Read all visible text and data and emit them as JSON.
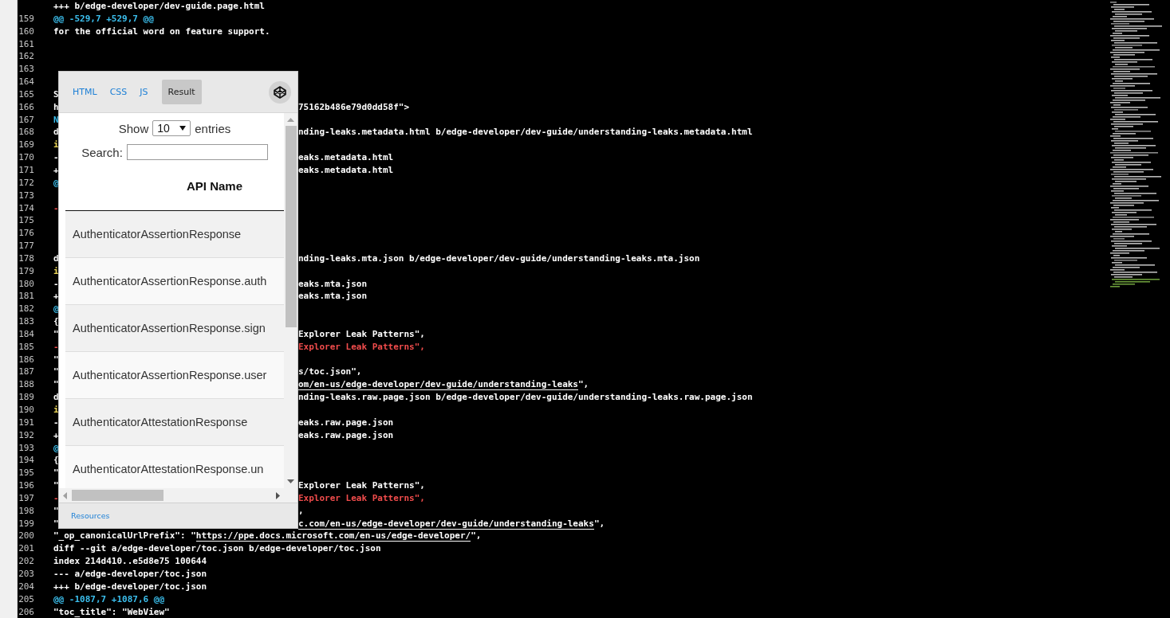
{
  "editor": {
    "lines": [
      {
        "left": [
          {
            "text": "+++ b/edge-developer/dev-guide.page.html",
            "kind": "plain",
            "link": false
          }
        ]
      },
      {
        "number": "159",
        "left": [
          {
            "text": "@@ -529,7 +529,7 @@",
            "kind": "hunk",
            "link": false
          }
        ]
      },
      {
        "number": "160",
        "left": [
          {
            "text": "for the official word on feature support.",
            "kind": "plain",
            "link": false
          }
        ]
      },
      {
        "number": "161"
      },
      {
        "number": "162"
      },
      {
        "number": "163"
      },
      {
        "number": "164"
      },
      {
        "number": "165",
        "left": [
          {
            "text": "S",
            "kind": "plain",
            "link": false
          }
        ]
      },
      {
        "number": "166",
        "left": [
          {
            "text": "h",
            "kind": "plain",
            "link": false
          }
        ],
        "right": [
          {
            "text": "75162b486e79d0dd58f\">",
            "kind": "plain",
            "link": false
          }
        ]
      },
      {
        "number": "167",
        "left": [
          {
            "text": "N",
            "kind": "hunk",
            "link": false
          }
        ]
      },
      {
        "number": "168",
        "left": [
          {
            "text": "d",
            "kind": "plain",
            "link": false
          }
        ],
        "right": [
          {
            "text": "nding-leaks.metadata.html b/edge-developer/dev-guide/understanding-leaks.metadata.html",
            "kind": "plain",
            "link": false
          }
        ]
      },
      {
        "number": "169",
        "left": [
          {
            "text": "i",
            "kind": "meta",
            "link": false
          }
        ]
      },
      {
        "number": "170",
        "left": [
          {
            "text": "-",
            "kind": "plain",
            "link": false
          }
        ],
        "right": [
          {
            "text": "eaks.metadata.html",
            "kind": "plain",
            "link": false
          }
        ]
      },
      {
        "number": "171",
        "left": [
          {
            "text": "+",
            "kind": "plain",
            "link": false
          }
        ],
        "right": [
          {
            "text": "eaks.metadata.html",
            "kind": "plain",
            "link": false
          }
        ]
      },
      {
        "number": "172",
        "left": [
          {
            "text": "@",
            "kind": "hunk",
            "link": false
          }
        ]
      },
      {
        "number": "173"
      },
      {
        "number": "174",
        "left": [
          {
            "text": "-",
            "kind": "removed",
            "link": false
          }
        ]
      },
      {
        "number": "175"
      },
      {
        "number": "176"
      },
      {
        "number": "177"
      },
      {
        "number": "178",
        "left": [
          {
            "text": "d",
            "kind": "plain",
            "link": false
          }
        ],
        "right": [
          {
            "text": "nding-leaks.mta.json b/edge-developer/dev-guide/understanding-leaks.mta.json",
            "kind": "plain",
            "link": false
          }
        ]
      },
      {
        "number": "179",
        "left": [
          {
            "text": "i",
            "kind": "meta",
            "link": false
          }
        ]
      },
      {
        "number": "180",
        "left": [
          {
            "text": "-",
            "kind": "plain",
            "link": false
          }
        ],
        "right": [
          {
            "text": "eaks.mta.json",
            "kind": "plain",
            "link": false
          }
        ]
      },
      {
        "number": "181",
        "left": [
          {
            "text": "+",
            "kind": "plain",
            "link": false
          }
        ],
        "right": [
          {
            "text": "eaks.mta.json",
            "kind": "plain",
            "link": false
          }
        ]
      },
      {
        "number": "182",
        "left": [
          {
            "text": "@",
            "kind": "hunk",
            "link": false
          }
        ]
      },
      {
        "number": "183",
        "left": [
          {
            "text": "{",
            "kind": "plain",
            "link": false
          }
        ]
      },
      {
        "number": "184",
        "left": [
          {
            "text": "\"",
            "kind": "plain",
            "link": false
          }
        ],
        "right": [
          {
            "text": "Explorer Leak Patterns\",",
            "kind": "plain",
            "link": false
          }
        ]
      },
      {
        "number": "185",
        "left": [
          {
            "text": "-",
            "kind": "removed",
            "link": false
          }
        ],
        "right": [
          {
            "text": "Explorer Leak Patterns\",",
            "kind": "removed",
            "link": false
          }
        ]
      },
      {
        "number": "186",
        "left": [
          {
            "text": "\"",
            "kind": "plain",
            "link": false
          }
        ]
      },
      {
        "number": "187",
        "left": [
          {
            "text": "\"",
            "kind": "plain",
            "link": false
          }
        ],
        "right": [
          {
            "text": "s/toc.json\",",
            "kind": "plain",
            "link": false
          }
        ]
      },
      {
        "number": "188",
        "left": [
          {
            "text": "\"",
            "kind": "plain",
            "link": false
          }
        ],
        "right": [
          {
            "text": "om/en-us/edge-developer/dev-guide/understanding-leaks",
            "kind": "plain",
            "link": true
          },
          {
            "text": "\",",
            "kind": "plain",
            "link": false
          }
        ]
      },
      {
        "number": "189",
        "left": [
          {
            "text": "d",
            "kind": "plain",
            "link": false
          }
        ],
        "right": [
          {
            "text": "nding-leaks.raw.page.json b/edge-developer/dev-guide/understanding-leaks.raw.page.json",
            "kind": "plain",
            "link": false
          }
        ]
      },
      {
        "number": "190",
        "left": [
          {
            "text": "i",
            "kind": "meta",
            "link": false
          }
        ]
      },
      {
        "number": "191",
        "left": [
          {
            "text": "-",
            "kind": "plain",
            "link": false
          }
        ],
        "right": [
          {
            "text": "eaks.raw.page.json",
            "kind": "plain",
            "link": false
          }
        ]
      },
      {
        "number": "192",
        "left": [
          {
            "text": "+",
            "kind": "plain",
            "link": false
          }
        ],
        "right": [
          {
            "text": "eaks.raw.page.json",
            "kind": "plain",
            "link": false
          }
        ]
      },
      {
        "number": "193",
        "left": [
          {
            "text": "@",
            "kind": "hunk",
            "link": false
          }
        ]
      },
      {
        "number": "194",
        "left": [
          {
            "text": "{",
            "kind": "plain",
            "link": false
          }
        ]
      },
      {
        "number": "195",
        "left": [
          {
            "text": "\"",
            "kind": "plain",
            "link": false
          }
        ]
      },
      {
        "number": "196",
        "left": [
          {
            "text": "\"",
            "kind": "plain",
            "link": false
          }
        ],
        "right": [
          {
            "text": "Explorer Leak Patterns\",",
            "kind": "plain",
            "link": false
          }
        ]
      },
      {
        "number": "197",
        "left": [
          {
            "text": "-",
            "kind": "removed",
            "link": false
          }
        ],
        "right": [
          {
            "text": "Explorer Leak Patterns\",",
            "kind": "removed",
            "link": false
          }
        ]
      },
      {
        "number": "198",
        "left": [
          {
            "text": "\"",
            "kind": "plain",
            "link": false
          }
        ],
        "right": [
          {
            "text": ",",
            "kind": "plain",
            "link": false
          }
        ]
      },
      {
        "number": "199",
        "left": [
          {
            "text": "\"",
            "kind": "plain",
            "link": false
          }
        ],
        "right": [
          {
            "text": "c.com/en-us/edge-developer/dev-guide/understanding-leaks",
            "kind": "plain",
            "link": true
          },
          {
            "text": "\",",
            "kind": "plain",
            "link": false
          }
        ]
      },
      {
        "number": "200",
        "left": [
          {
            "text": "\"_op_canonicalUrlPrefix\": \"",
            "kind": "plain",
            "link": false
          },
          {
            "text": "https://ppe.docs.microsoft.com/en-us/edge-developer/",
            "kind": "plain",
            "link": true
          },
          {
            "text": "\",",
            "kind": "plain",
            "link": false
          }
        ]
      },
      {
        "number": "201",
        "left": [
          {
            "text": "diff --git a/edge-developer/toc.json b/edge-developer/toc.json",
            "kind": "plain",
            "link": false
          }
        ]
      },
      {
        "number": "202",
        "left": [
          {
            "text": "index 214d410..e5d8e75 100644",
            "kind": "plain",
            "link": false
          }
        ]
      },
      {
        "number": "203",
        "left": [
          {
            "text": "--- a/edge-developer/toc.json",
            "kind": "plain",
            "link": false
          }
        ]
      },
      {
        "number": "204",
        "left": [
          {
            "text": "+++ b/edge-developer/toc.json",
            "kind": "plain",
            "link": false
          }
        ]
      },
      {
        "number": "205",
        "left": [
          {
            "text": "@@ -1087,7 +1087,6 @@",
            "kind": "hunk",
            "link": false
          }
        ]
      },
      {
        "number": "206",
        "left": [
          {
            "text": "\"toc_title\": \"WebView\"",
            "kind": "plain",
            "link": false
          }
        ]
      }
    ]
  },
  "embed": {
    "tabs": [
      {
        "label": "HTML",
        "selected": false
      },
      {
        "label": "CSS",
        "selected": false
      },
      {
        "label": "JS",
        "selected": false
      },
      {
        "label": "Result",
        "selected": true
      }
    ],
    "show_label": "Show",
    "page_size": "10",
    "entries_label": "entries",
    "search_label": "Search:",
    "table": {
      "columns": [
        "API Name"
      ],
      "rows": [
        "AuthenticatorAssertionResponse",
        "AuthenticatorAssertionResponse.auth",
        "AuthenticatorAssertionResponse.sign",
        "AuthenticatorAssertionResponse.user",
        "AuthenticatorAttestationResponse",
        "AuthenticatorAttestationResponse.un"
      ]
    },
    "footer_link": "Resources"
  }
}
